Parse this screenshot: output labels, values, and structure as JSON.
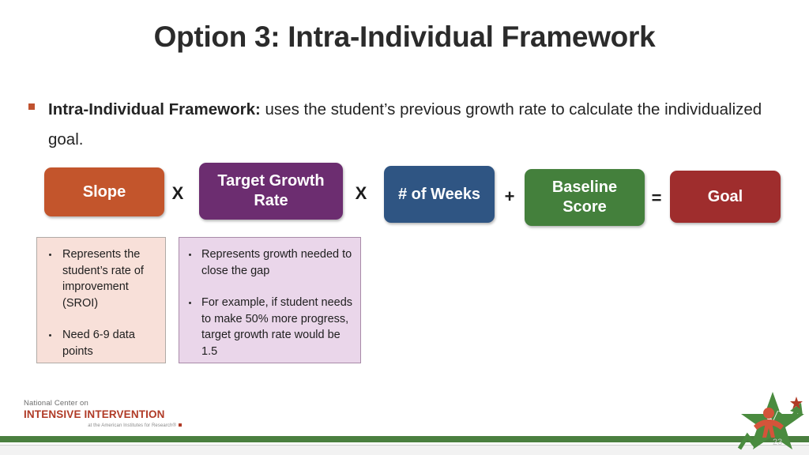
{
  "slide": {
    "title": "Option 3: Intra-Individual Framework",
    "page_number": "23"
  },
  "bullet": {
    "lead": "Intra-Individual Framework:",
    "rest": " uses the student’s previous growth rate to calculate the individualized goal."
  },
  "formula": {
    "boxes": [
      {
        "id": "slope",
        "label": "Slope",
        "color": "#c3552c"
      },
      {
        "id": "tgr",
        "label": "Target Growth Rate",
        "color": "#6c2d70"
      },
      {
        "id": "weeks",
        "label": "# of Weeks",
        "color": "#2f5583"
      },
      {
        "id": "baseline",
        "label": "Baseline Score",
        "color": "#44803c"
      },
      {
        "id": "goal",
        "label": "Goal",
        "color": "#9f2d2d"
      }
    ],
    "operators": [
      "X",
      "X",
      "+",
      "="
    ]
  },
  "notes": [
    {
      "id": "slope-note",
      "fill": "#f8e0d9",
      "items": [
        "Represents the student’s rate of improvement (SROI)",
        "Need 6-9 data points"
      ]
    },
    {
      "id": "tgr-note",
      "fill": "#ead6ea",
      "items": [
        "Represents growth needed to close the gap",
        "For example, if student needs to make 50% more progress, target growth rate would be 1.5"
      ]
    }
  ],
  "footer": {
    "logo_line1": "National Center on",
    "logo_line2": "INTENSIVE INTERVENTION",
    "logo_line3": "at the American Institutes for Research®"
  }
}
